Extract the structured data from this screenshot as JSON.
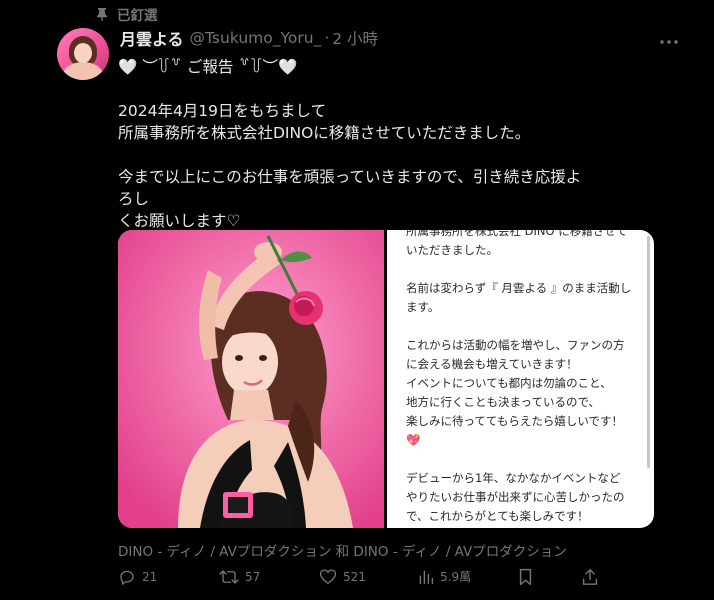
{
  "pinned": {
    "label": "已釘選",
    "icon": "pin-icon"
  },
  "author": {
    "name": "月雲よる",
    "handle": "@Tsukumo_Yoru_",
    "separator": "·",
    "time": "2 小時",
    "avatar_icon": "avatar"
  },
  "tweet": {
    "heading": "🤍 ︶꒦꒷ ご報告 ꒷꒦︶🤍",
    "line1": "2024年4月19日をもちまして",
    "line2": "所属事務所を株式会社DINOに移籍させていただきました。",
    "line3": "今まで以上にこのお仕事を頑張っていきますので、引き続き応援よろし",
    "line4": "くお願いします♡"
  },
  "note": {
    "p1a": "所属事務所を株式会社 DINO に移籍させて",
    "p1b": "いただきました。",
    "p2a": "名前は変わらず『 月雲よる 』のまま活動し",
    "p2b": "ます。",
    "p3a": "これからは活動の幅を増やし、ファンの方",
    "p3b": "に会える機会も増えていきます！",
    "p3c": "イベントについても都内は勿論のこと、",
    "p3d": "地方に行くことも決まっているので、",
    "p3e": "楽しみに待っててもらえたら嬉しいです！",
    "p3f": "💖",
    "p4a": "デビューから1年、なかなかイベントなど",
    "p4b": "やりたいお仕事が出来ずに心苦しかったの",
    "p4c": "で、これからがとても楽しみです！"
  },
  "card_caption": "DINO - ディノ / AVプロダクション 和 DINO - ディノ / AVプロダクション",
  "actions": {
    "replies": "21",
    "retweets": "57",
    "likes": "521",
    "views": "5.9萬"
  },
  "colors": {
    "background": "#000000",
    "text": "#e7e9ea",
    "muted": "#71767b",
    "photo_pink": "#f1519e"
  }
}
